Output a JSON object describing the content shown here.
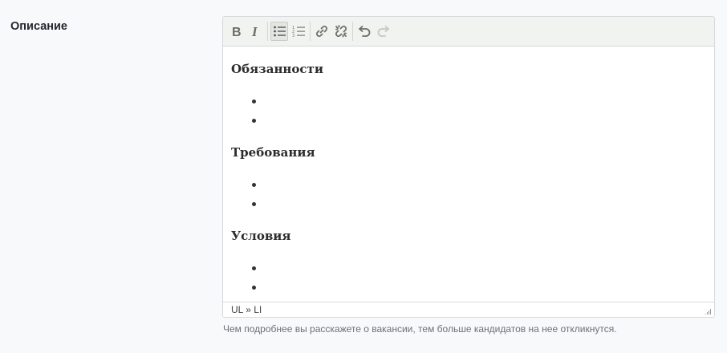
{
  "field": {
    "label": "Описание",
    "hint": "Чем подробнее вы расскажете о вакансии, тем больше кандидатов на нее откликнутся."
  },
  "toolbar": {
    "buttons": [
      {
        "icon": "bold-icon"
      },
      {
        "icon": "italic-icon"
      },
      {
        "icon": "bulleted-list-icon",
        "active": true
      },
      {
        "icon": "numbered-list-icon"
      },
      {
        "icon": "link-icon"
      },
      {
        "icon": "unlink-icon"
      },
      {
        "icon": "undo-icon"
      },
      {
        "icon": "redo-icon",
        "disabled": true
      }
    ]
  },
  "content": {
    "sections": [
      {
        "heading": "Обязанности",
        "bullet_count": 2
      },
      {
        "heading": "Требования",
        "bullet_count": 2
      },
      {
        "heading": "Условия",
        "bullet_count": 2
      }
    ]
  },
  "statusbar": {
    "path": "UL » LI"
  },
  "colors": {
    "toolbar_bg": "#f1f3f1",
    "border": "#d6d9dc",
    "page_bg": "#f8f9fa"
  }
}
